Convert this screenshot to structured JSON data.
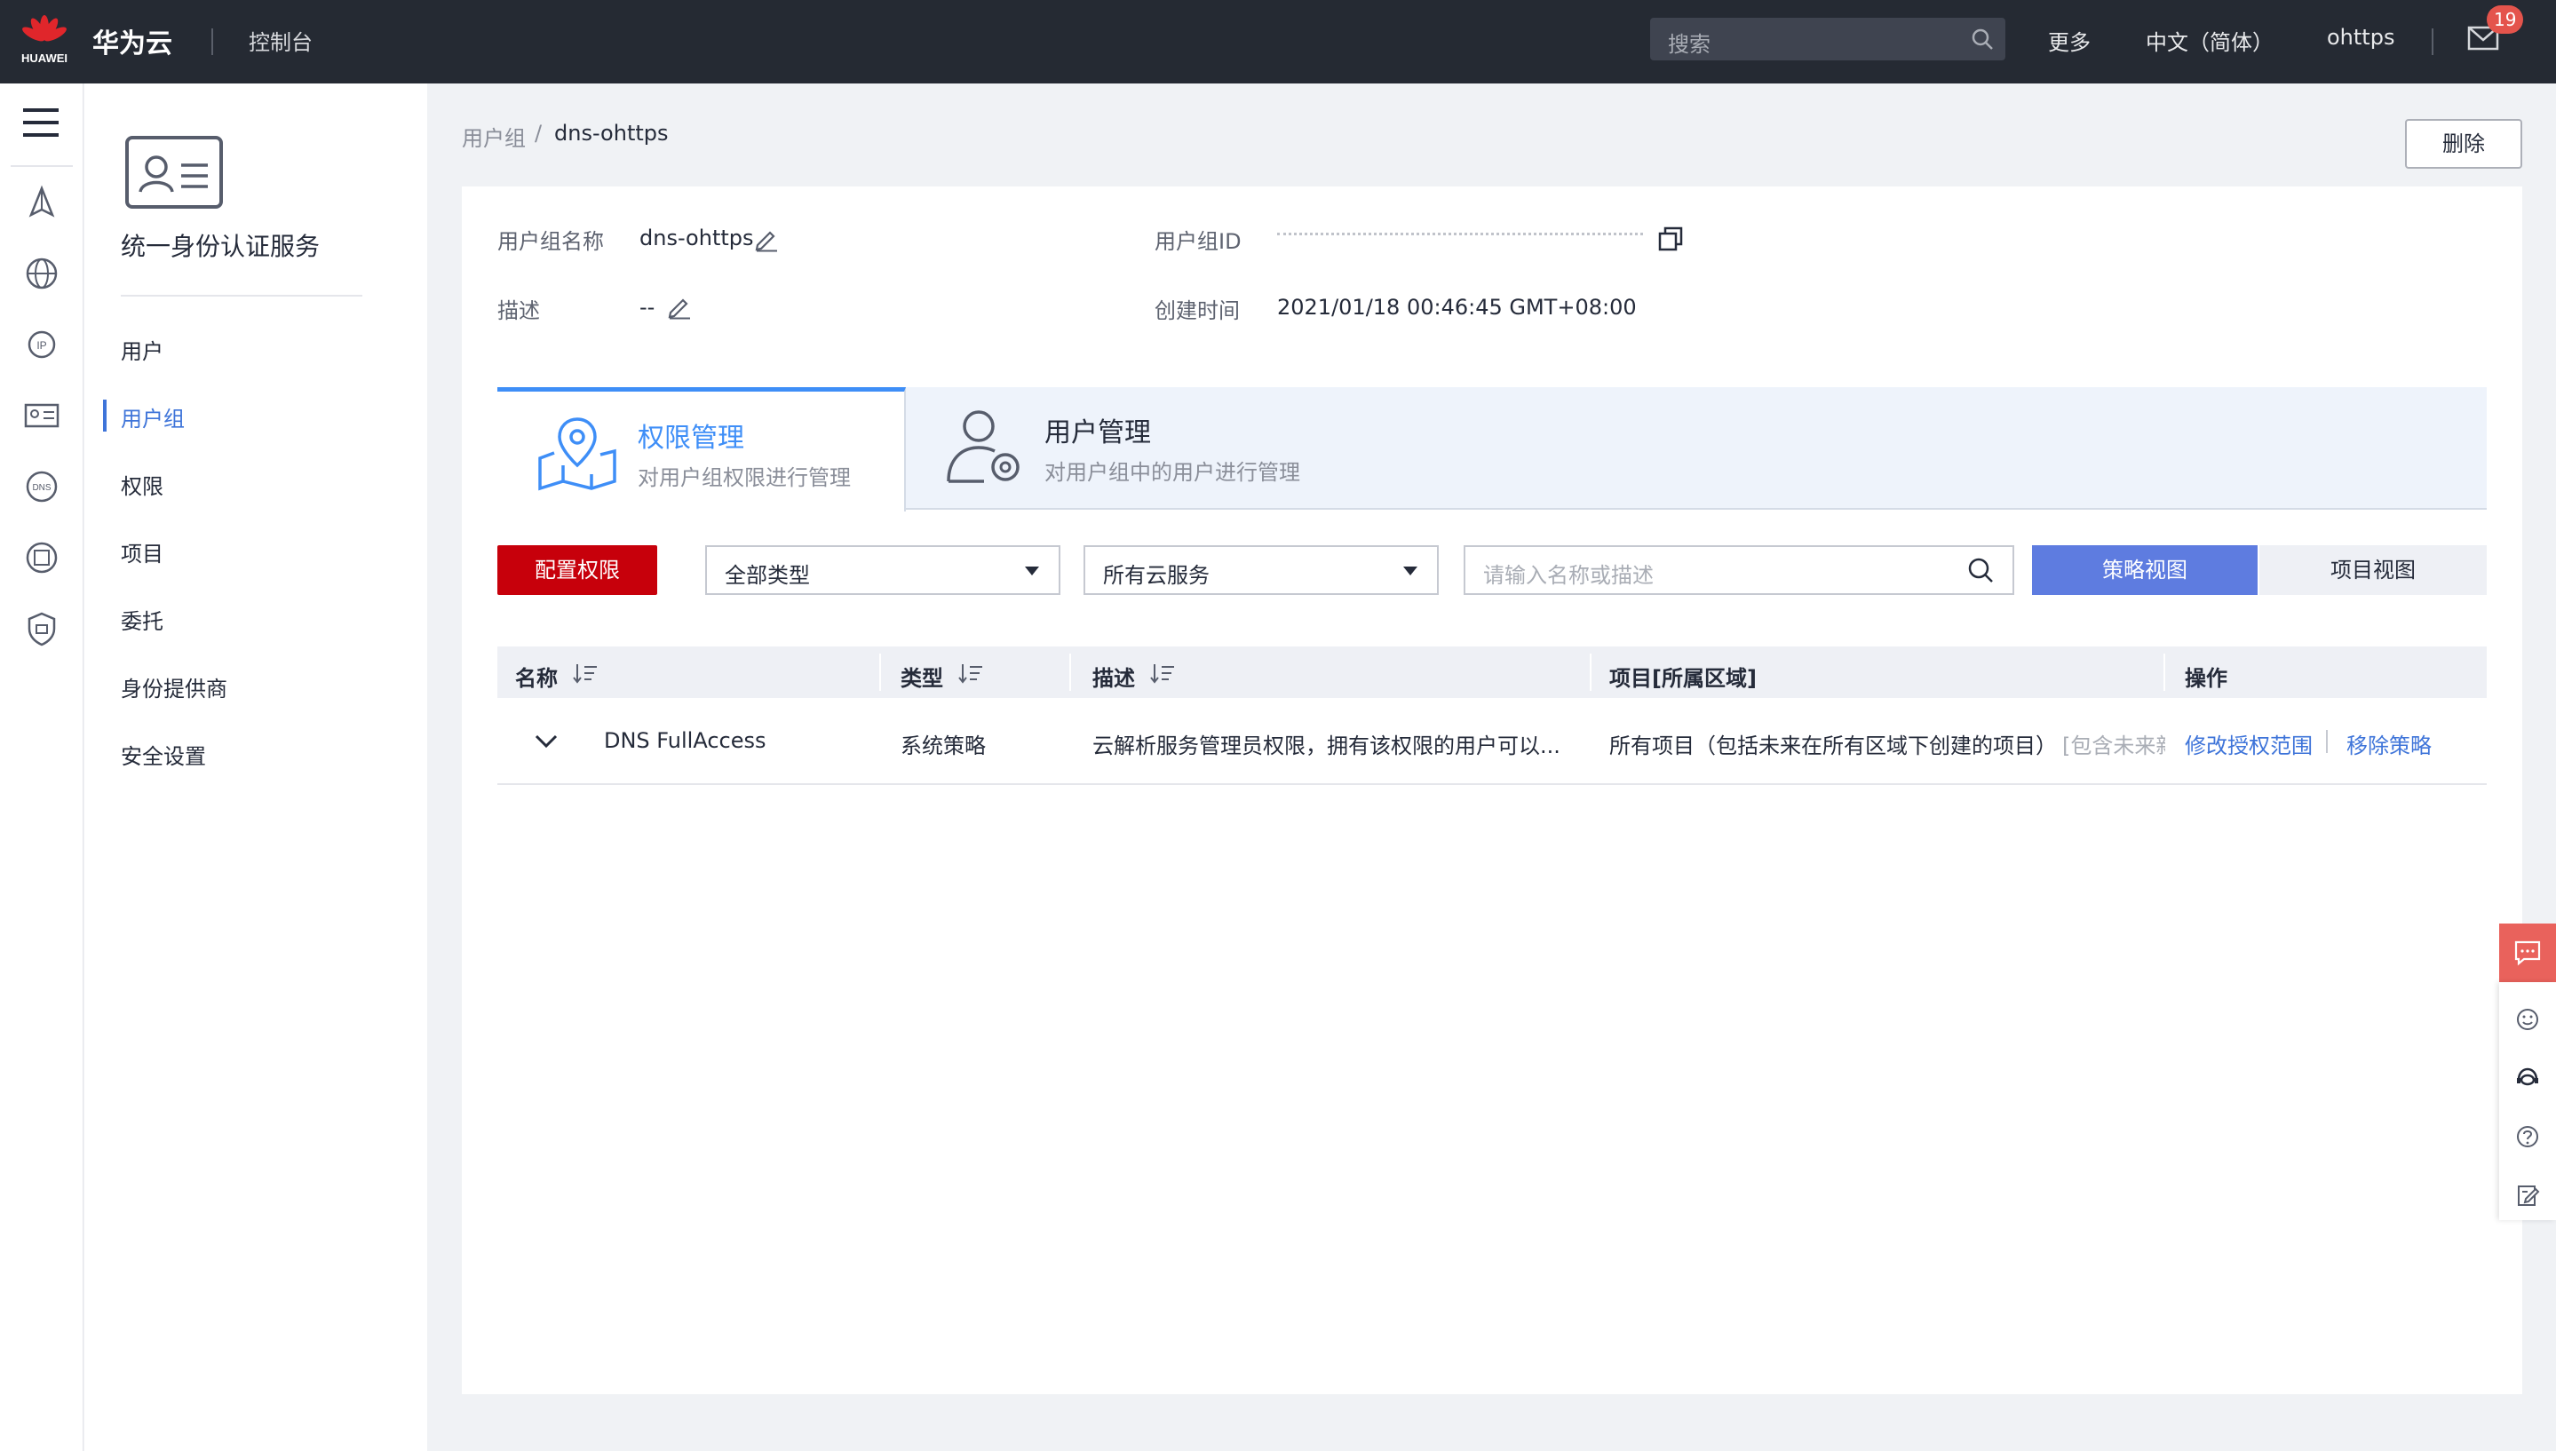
{
  "topbar": {
    "logo_text": "HUAWEI",
    "brand": "华为云",
    "console": "控制台",
    "search_placeholder": "搜索",
    "more": "更多",
    "language": "中文（简体）",
    "username": "ohttps",
    "notification_count": "19"
  },
  "sidebar": {
    "service_title": "统一身份认证服务",
    "items": [
      {
        "label": "用户"
      },
      {
        "label": "用户组"
      },
      {
        "label": "权限"
      },
      {
        "label": "项目"
      },
      {
        "label": "委托"
      },
      {
        "label": "身份提供商"
      },
      {
        "label": "安全设置"
      }
    ]
  },
  "breadcrumb": {
    "parent": "用户组",
    "separator": "/",
    "current": "dns-ohttps"
  },
  "actions": {
    "delete": "删除"
  },
  "details": {
    "name_label": "用户组名称",
    "name_value": "dns-ohttps",
    "desc_label": "描述",
    "desc_value": "--",
    "id_label": "用户组ID",
    "created_label": "创建时间",
    "created_value": "2021/01/18 00:46:45 GMT+08:00"
  },
  "tabs": [
    {
      "title": "权限管理",
      "subtitle": "对用户组权限进行管理",
      "active": true
    },
    {
      "title": "用户管理",
      "subtitle": "对用户组中的用户进行管理",
      "active": false
    }
  ],
  "toolbar": {
    "configure": "配置权限",
    "type_select": "全部类型",
    "service_select": "所有云服务",
    "search_placeholder": "请输入名称或描述",
    "policy_view": "策略视图",
    "project_view": "项目视图"
  },
  "table": {
    "columns": [
      "名称",
      "类型",
      "描述",
      "项目[所属区域]",
      "操作"
    ],
    "rows": [
      {
        "name": "DNS FullAccess",
        "type": "系统策略",
        "description": "云解析服务管理员权限，拥有该权限的用户可以...",
        "project": "所有项目（包括未来在所有区域下创建的项目）",
        "project_extra": "[包含未来新",
        "action_modify": "修改授权范围",
        "action_remove": "移除策略"
      }
    ]
  },
  "colors": {
    "topbar": "#252a33",
    "primary_red": "#c7000b",
    "accent_blue": "#3e74d9",
    "view_button": "#5e7ce0",
    "badge": "#e4544c"
  }
}
